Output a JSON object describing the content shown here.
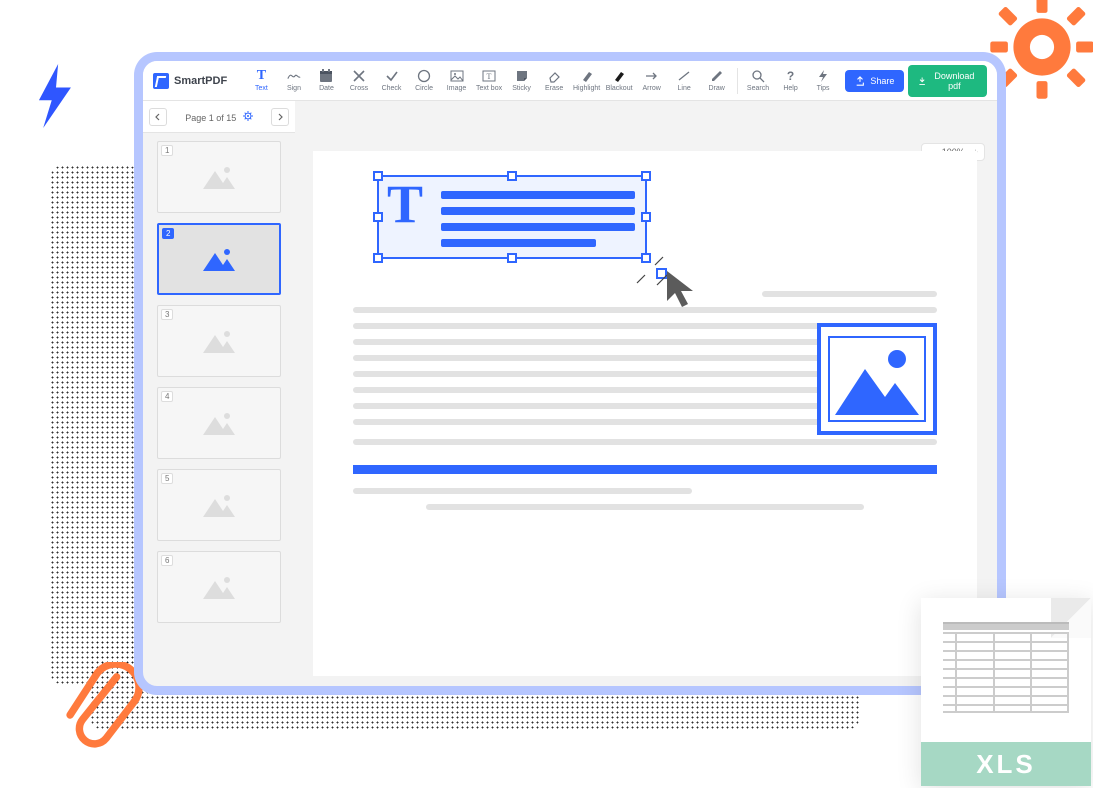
{
  "brand": "SmartPDF",
  "tools": [
    {
      "label": "Text"
    },
    {
      "label": "Sign"
    },
    {
      "label": "Date"
    },
    {
      "label": "Cross"
    },
    {
      "label": "Check"
    },
    {
      "label": "Circle"
    },
    {
      "label": "Image"
    },
    {
      "label": "Text box"
    },
    {
      "label": "Sticky"
    },
    {
      "label": "Erase"
    },
    {
      "label": "Highlight"
    },
    {
      "label": "Blackout"
    },
    {
      "label": "Arrow"
    },
    {
      "label": "Line"
    },
    {
      "label": "Draw"
    }
  ],
  "utils": [
    {
      "label": "Search"
    },
    {
      "label": "Help"
    },
    {
      "label": "Tips"
    }
  ],
  "buttons": {
    "share": "Share",
    "download": "Download pdf"
  },
  "page_info": "Page 1 of 15",
  "zoom": "100%",
  "thumbs": [
    {
      "n": "1"
    },
    {
      "n": "2"
    },
    {
      "n": "3"
    },
    {
      "n": "4"
    },
    {
      "n": "5"
    },
    {
      "n": "6"
    }
  ],
  "active_tool": "Text",
  "selected_thumb": 2,
  "xls_label": "XLS"
}
